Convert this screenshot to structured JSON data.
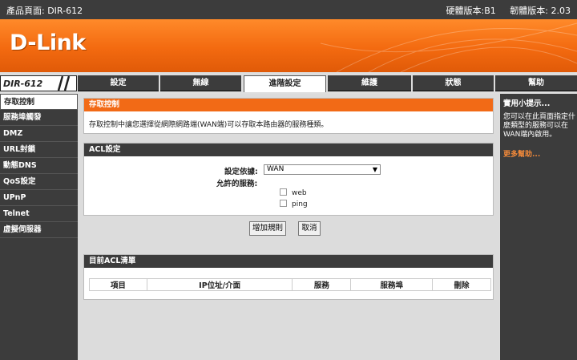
{
  "top": {
    "product_page": "產品頁面: DIR-612",
    "hardware_version": "硬體版本:B1",
    "firmware_version": "韌體版本: 2.03"
  },
  "brand": {
    "logo_text": "D-Link"
  },
  "model": {
    "name": "DIR-612"
  },
  "tabs": [
    {
      "label": "設定",
      "active": false
    },
    {
      "label": "無線",
      "active": false
    },
    {
      "label": "進階設定",
      "active": true
    },
    {
      "label": "維護",
      "active": false
    },
    {
      "label": "狀態",
      "active": false
    },
    {
      "label": "幫助",
      "active": false
    }
  ],
  "sidebar": {
    "items": [
      {
        "label": "存取控制",
        "active": true
      },
      {
        "label": "服務埠觸發",
        "active": false
      },
      {
        "label": "DMZ",
        "active": false
      },
      {
        "label": "URL封鎖",
        "active": false
      },
      {
        "label": "動態DNS",
        "active": false
      },
      {
        "label": "QoS設定",
        "active": false
      },
      {
        "label": "UPnP",
        "active": false
      },
      {
        "label": "Telnet",
        "active": false
      },
      {
        "label": "虛擬伺服器",
        "active": false
      }
    ]
  },
  "access_control": {
    "title": "存取控制",
    "description": "存取控制中讓您選擇從網際網路端(WAN端)可以存取本路由器的服務種類。"
  },
  "acl_settings": {
    "title": "ACL設定",
    "rule_based_label": "設定依據:",
    "rule_based_value": "WAN",
    "allowed_services_label": "允許的服務:",
    "services": [
      "web",
      "ping"
    ]
  },
  "buttons": {
    "add_rule": "增加規則",
    "cancel": "取消"
  },
  "acl_list": {
    "title": "目前ACL清單",
    "columns": [
      "項目",
      "IP位址/介面",
      "服務",
      "服務埠",
      "刪除"
    ]
  },
  "help": {
    "title": "實用小提示...",
    "body": "您可以在此頁面指定什麼類型的服務可以在WAN端內啟用。",
    "more_link": "更多幫助..."
  },
  "colors": {
    "orange": "#f26a16",
    "dark": "#3c3c3c",
    "link_orange": "#f48a3a"
  }
}
